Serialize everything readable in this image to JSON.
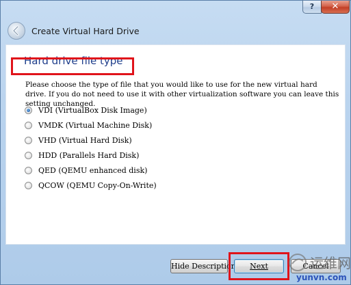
{
  "window": {
    "title": "Create Virtual Hard Drive",
    "help_label": "?",
    "close_label": "✕"
  },
  "page": {
    "heading": "Hard drive file type",
    "description": "Please choose the type of file that you would like to use for the new virtual hard drive. If you do not need to use it with other virtualization software you can leave this setting unchanged."
  },
  "options": [
    {
      "label": "VDI (VirtualBox Disk Image)",
      "selected": true
    },
    {
      "label": "VMDK (Virtual Machine Disk)",
      "selected": false
    },
    {
      "label": "VHD (Virtual Hard Disk)",
      "selected": false
    },
    {
      "label": "HDD (Parallels Hard Disk)",
      "selected": false
    },
    {
      "label": "QED (QEMU enhanced disk)",
      "selected": false
    },
    {
      "label": "QCOW (QEMU Copy-On-Write)",
      "selected": false
    }
  ],
  "buttons": {
    "hide_description": "Hide Description",
    "next": "Next",
    "cancel": "Cancel"
  },
  "watermark": {
    "text_cn": "运维网",
    "url": "yunvn.com"
  },
  "colors": {
    "heading": "#1f3d8a",
    "highlight": "#e0131a",
    "chrome": "#b9d3ee"
  },
  "icons": {
    "back": "back-arrow-icon",
    "help": "help-icon",
    "close": "close-icon"
  }
}
